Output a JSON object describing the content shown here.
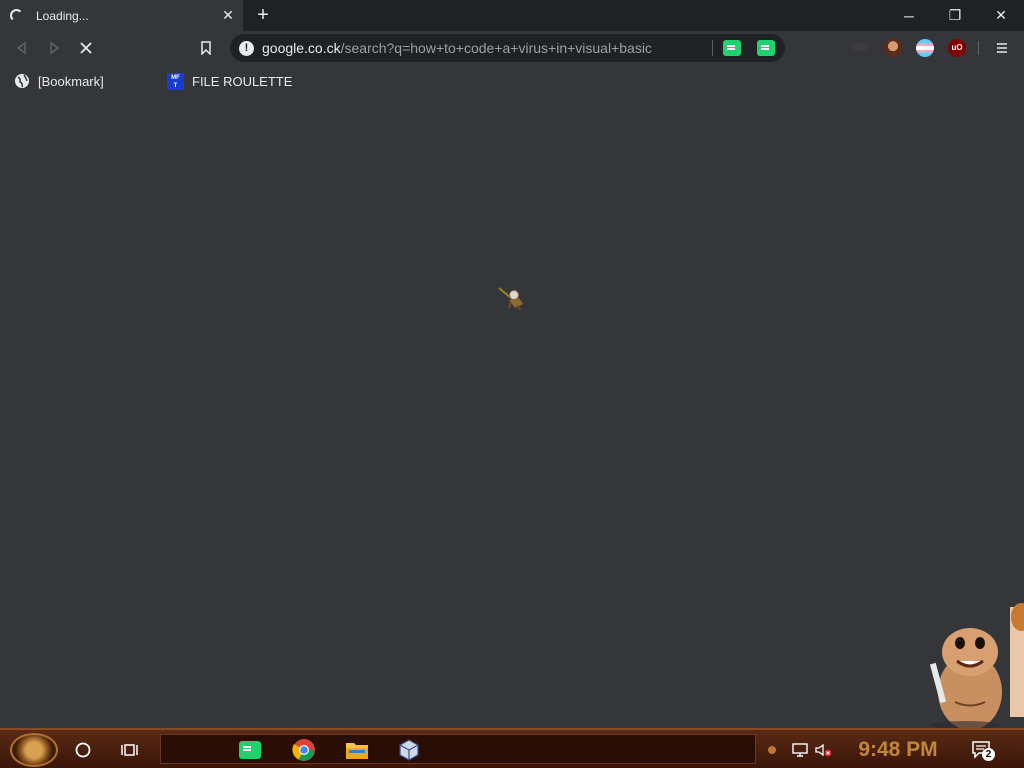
{
  "tab": {
    "title": "Loading...",
    "close_icon": "close-icon"
  },
  "window": {
    "minimize": "─",
    "restore": "❐",
    "close": "✕"
  },
  "omnibox": {
    "host": "google.co.ck",
    "path": "/search?q=how+to+code+a+virus+in+visual+basic"
  },
  "bookmarks": [
    {
      "label": "[Bookmark]",
      "icon": "globe-icon"
    },
    {
      "label": "FILE ROULETTE",
      "icon": "mft-icon"
    }
  ],
  "taskbar": {
    "time": "9:48 PM",
    "notification_count": "2"
  },
  "colors": {
    "accent_green": "#1ed26e",
    "clock": "#c0873a",
    "taskbar": "#4a200e"
  }
}
